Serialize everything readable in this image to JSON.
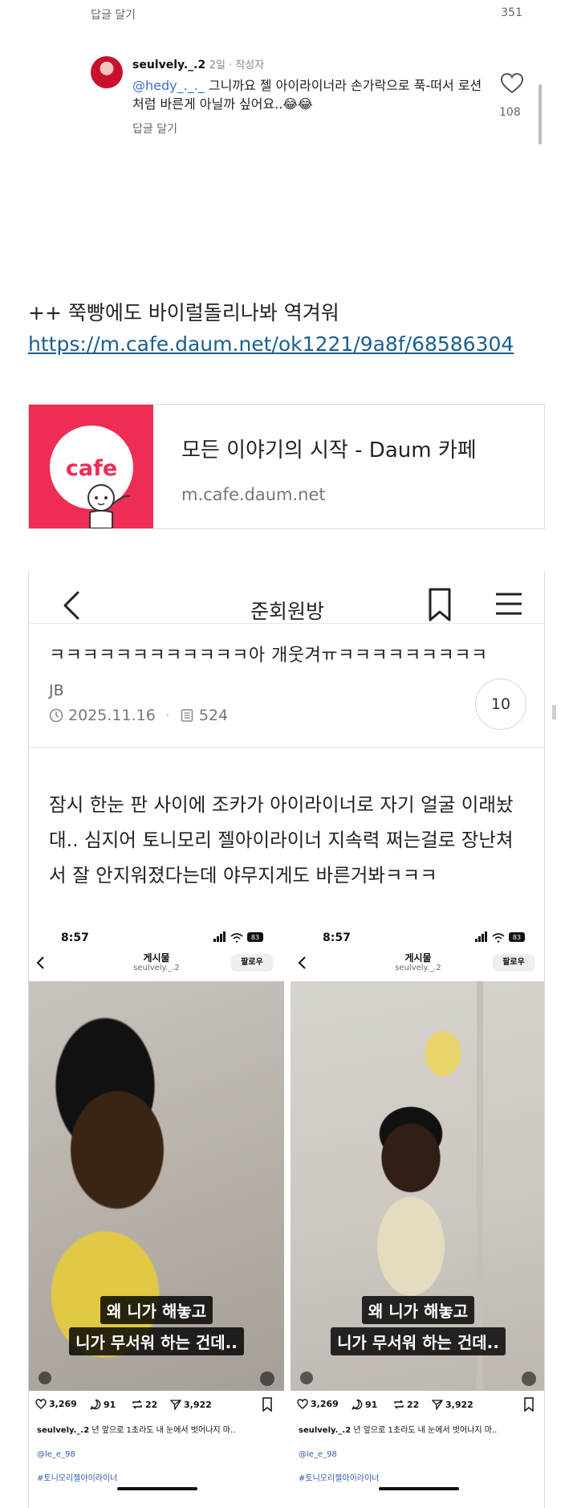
{
  "top_comment_bar": {
    "reply_label": "답글 달기",
    "count": "351"
  },
  "comment": {
    "username": "seulvely._.2",
    "meta": "2일 · 작성자",
    "mention": "@hedy_._._",
    "text": " 그니까요 젤 아이라이너라 손가락으로 푹-떠서 로션처럼 바른게 아닐까 싶어요..😂😂",
    "reply_label": "답글 달기",
    "like_count": "108"
  },
  "post": {
    "line": "++ 쭉빵에도 바이럴돌리나봐 역겨워",
    "link": "https://m.cafe.daum.net/ok1221/9a8f/68586304"
  },
  "link_card": {
    "thumb_text": "cafe",
    "title": "모든 이야기의 시작 - Daum 카페",
    "domain": "m.cafe.daum.net",
    "brand_color": "#ee2d54"
  },
  "embed": {
    "header_title": "준회원방",
    "headline": "ㅋㅋㅋㅋㅋㅋㅋㅋㅋㅋㅋㅋ아 개웃겨ㅠㅋㅋㅋㅋㅋㅋㅋㅋㅋ",
    "author": "JB",
    "date": "2025.11.16",
    "views": "524",
    "comment_count": "10",
    "body": "잠시 한눈 판 사이에 조카가 아이라이너로 자기 얼굴 이래놨대.. 심지어 토니모리 젤아이라이너 지속력 쩌는걸로 장난쳐서 잘 안지워졌다는데 야무지게도 바른거봐ㅋㅋㅋ"
  },
  "phone_shots": [
    {
      "time": "8:57",
      "battery": "83",
      "title": "게시물",
      "subtitle": "seulvely._.2",
      "follow": "팔로우",
      "caption_1": "왜 니가 해놓고",
      "caption_2": "니가 무서워 하는 건데..",
      "likes": "3,269",
      "comments": "91",
      "reposts": "22",
      "shares": "3,922",
      "desc_user": "seulvely._.2",
      "desc_text": " 년 앞으로 1초라도 내 눈에서 벗어나지 마..",
      "tag1": "@le_e_98",
      "tag2": "#토니모리젤아이라이너"
    },
    {
      "time": "8:57",
      "battery": "83",
      "title": "게시물",
      "subtitle": "seulvely._.2",
      "follow": "팔로우",
      "caption_1": "왜 니가 해놓고",
      "caption_2": "니가 무서워 하는 건데..",
      "likes": "3,269",
      "comments": "91",
      "reposts": "22",
      "shares": "3,922",
      "desc_user": "seulvely._.2",
      "desc_text": " 년 앞으로 1초라도 내 눈에서 벗어나지 마..",
      "tag1": "@le_e_98",
      "tag2": "#토니모리젤아이라이너"
    }
  ]
}
